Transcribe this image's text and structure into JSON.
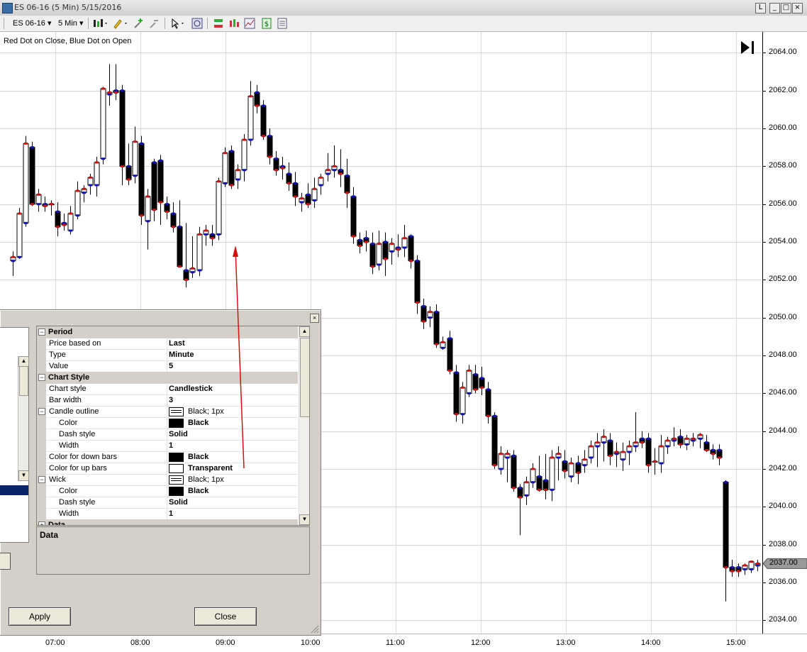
{
  "window": {
    "title": "ES 06-16 (5 Min)  5/15/2016",
    "buttons": [
      "L",
      "_",
      "□",
      "×"
    ]
  },
  "toolbar": {
    "instrument": "ES 06-16",
    "interval": "5 Min"
  },
  "chart": {
    "label": "Red Dot on Close, Blue Dot on Open",
    "current_price": "2037.00"
  },
  "chart_data": {
    "type": "candlestick",
    "title": "",
    "price_ticks": [
      "2064.00",
      "2062.00",
      "2060.00",
      "2058.00",
      "2056.00",
      "2054.00",
      "2052.00",
      "2050.00",
      "2048.00",
      "2046.00",
      "2044.00",
      "2042.00",
      "2040.00",
      "2038.00",
      "2036.00",
      "2034.00"
    ],
    "time_ticks": [
      "07:00",
      "08:00",
      "09:00",
      "10:00",
      "11:00",
      "12:00",
      "13:00",
      "14:00",
      "15:00"
    ],
    "ylim": [
      2033.3,
      2065.1
    ],
    "grid": true,
    "colors": {
      "up_fill": "#ffffff",
      "down_fill": "#000000",
      "outline": "#000000",
      "close_dot": "#d01010",
      "open_dot": "#1010c0"
    },
    "bars": [
      [
        2053.0,
        2053.5,
        2052.2,
        2053.2
      ],
      [
        2053.2,
        2055.8,
        2053.1,
        2055.5
      ],
      [
        2055.0,
        2059.6,
        2054.8,
        2059.2
      ],
      [
        2059.0,
        2059.3,
        2055.9,
        2056.0
      ],
      [
        2056.0,
        2056.8,
        2055.6,
        2056.5
      ],
      [
        2056.0,
        2056.4,
        2055.6,
        2055.9
      ],
      [
        2056.0,
        2056.2,
        2055.4,
        2056.0
      ],
      [
        2055.6,
        2056.1,
        2054.3,
        2054.8
      ],
      [
        2055.0,
        2055.5,
        2054.6,
        2054.9
      ],
      [
        2054.6,
        2055.9,
        2054.4,
        2055.5
      ],
      [
        2055.4,
        2057.2,
        2055.2,
        2056.7
      ],
      [
        2056.6,
        2057.0,
        2056.1,
        2056.8
      ],
      [
        2057.0,
        2057.6,
        2056.5,
        2057.4
      ],
      [
        2057.0,
        2058.5,
        2056.4,
        2058.2
      ],
      [
        2058.4,
        2062.2,
        2058.1,
        2062.1
      ],
      [
        2061.8,
        2063.4,
        2061.2,
        2061.9
      ],
      [
        2062.0,
        2063.4,
        2061.5,
        2061.9
      ],
      [
        2062.0,
        2062.3,
        2057.0,
        2058.0
      ],
      [
        2058.0,
        2059.2,
        2057.0,
        2057.3
      ],
      [
        2057.5,
        2060.1,
        2057.1,
        2059.3
      ],
      [
        2059.2,
        2059.6,
        2054.9,
        2055.4
      ],
      [
        2055.1,
        2056.8,
        2053.6,
        2056.4
      ],
      [
        2058.2,
        2058.4,
        2055.1,
        2055.7
      ],
      [
        2058.3,
        2058.6,
        2054.9,
        2056.1
      ],
      [
        2056.0,
        2056.4,
        2055.2,
        2055.6
      ],
      [
        2055.5,
        2056.1,
        2054.5,
        2054.8
      ],
      [
        2054.8,
        2056.2,
        2053.3,
        2052.7
      ],
      [
        2052.5,
        2055.0,
        2051.6,
        2052.0
      ],
      [
        2052.4,
        2054.3,
        2052.1,
        2052.6
      ],
      [
        2052.5,
        2054.8,
        2052.2,
        2054.4
      ],
      [
        2054.4,
        2054.9,
        2053.8,
        2054.6
      ],
      [
        2054.4,
        2054.9,
        2053.8,
        2054.2
      ],
      [
        2054.4,
        2057.4,
        2054.1,
        2057.2
      ],
      [
        2057.1,
        2059.0,
        2056.9,
        2058.7
      ],
      [
        2058.8,
        2059.1,
        2056.8,
        2057.0
      ],
      [
        2057.3,
        2058.1,
        2056.8,
        2057.8
      ],
      [
        2057.8,
        2059.7,
        2057.2,
        2059.4
      ],
      [
        2059.4,
        2062.5,
        2059.1,
        2061.7
      ],
      [
        2061.9,
        2062.3,
        2060.8,
        2061.2
      ],
      [
        2061.2,
        2061.5,
        2059.4,
        2059.6
      ],
      [
        2059.6,
        2060.0,
        2058.1,
        2058.5
      ],
      [
        2058.4,
        2058.8,
        2057.5,
        2057.8
      ],
      [
        2058.0,
        2058.5,
        2057.3,
        2057.9
      ],
      [
        2057.6,
        2058.2,
        2056.7,
        2057.1
      ],
      [
        2057.1,
        2057.7,
        2055.9,
        2056.4
      ],
      [
        2056.1,
        2056.6,
        2055.6,
        2056.3
      ],
      [
        2056.5,
        2057.1,
        2055.8,
        2056.0
      ],
      [
        2056.2,
        2057.4,
        2055.8,
        2056.8
      ],
      [
        2057.0,
        2057.6,
        2056.5,
        2057.4
      ],
      [
        2057.6,
        2058.7,
        2057.2,
        2057.8
      ],
      [
        2057.8,
        2059.1,
        2057.4,
        2058.0
      ],
      [
        2057.8,
        2058.9,
        2056.9,
        2057.6
      ],
      [
        2057.5,
        2058.4,
        2055.8,
        2056.6
      ],
      [
        2056.4,
        2056.9,
        2053.9,
        2054.3
      ],
      [
        2054.1,
        2054.5,
        2053.4,
        2053.8
      ],
      [
        2054.2,
        2054.6,
        2053.5,
        2054.0
      ],
      [
        2053.9,
        2054.5,
        2052.3,
        2052.7
      ],
      [
        2052.8,
        2054.6,
        2052.5,
        2053.9
      ],
      [
        2054.0,
        2054.5,
        2052.2,
        2053.1
      ],
      [
        2053.5,
        2054.2,
        2052.8,
        2053.9
      ],
      [
        2053.7,
        2054.4,
        2053.2,
        2053.6
      ],
      [
        2053.7,
        2054.9,
        2053.2,
        2054.2
      ],
      [
        2054.3,
        2054.4,
        2052.6,
        2053.0
      ],
      [
        2053.0,
        2053.3,
        2050.2,
        2050.8
      ],
      [
        2050.6,
        2051.0,
        2049.4,
        2049.8
      ],
      [
        2050.0,
        2050.6,
        2049.5,
        2050.3
      ],
      [
        2050.3,
        2050.7,
        2048.4,
        2048.6
      ],
      [
        2048.4,
        2049.0,
        2048.3,
        2048.7
      ],
      [
        2048.9,
        2049.3,
        2047.0,
        2047.2
      ],
      [
        2047.1,
        2047.5,
        2044.5,
        2044.9
      ],
      [
        2044.9,
        2046.6,
        2044.4,
        2046.3
      ],
      [
        2046.0,
        2047.5,
        2045.8,
        2047.2
      ],
      [
        2047.0,
        2047.5,
        2046.0,
        2046.2
      ],
      [
        2046.8,
        2047.4,
        2045.9,
        2046.3
      ],
      [
        2046.2,
        2046.6,
        2044.4,
        2044.8
      ],
      [
        2044.8,
        2045.0,
        2042.0,
        2042.2
      ],
      [
        2042.0,
        2043.2,
        2041.7,
        2042.8
      ],
      [
        2042.6,
        2043.0,
        2041.3,
        2042.8
      ],
      [
        2042.7,
        2043.0,
        2040.8,
        2041.0
      ],
      [
        2041.0,
        2041.2,
        2038.5,
        2040.5
      ],
      [
        2040.6,
        2041.6,
        2040.1,
        2041.3
      ],
      [
        2041.3,
        2042.3,
        2041.0,
        2042.0
      ],
      [
        2041.6,
        2042.7,
        2040.8,
        2040.9
      ],
      [
        2041.4,
        2042.8,
        2040.4,
        2040.9
      ],
      [
        2040.9,
        2043.0,
        2040.3,
        2042.6
      ],
      [
        2042.6,
        2043.2,
        2041.4,
        2042.8
      ],
      [
        2042.4,
        2043.0,
        2041.5,
        2041.9
      ],
      [
        2041.6,
        2042.6,
        2041.3,
        2042.3
      ],
      [
        2042.3,
        2042.7,
        2041.2,
        2041.8
      ],
      [
        2042.2,
        2043.0,
        2041.8,
        2042.5
      ],
      [
        2042.6,
        2043.5,
        2042.3,
        2043.2
      ],
      [
        2043.2,
        2043.9,
        2042.1,
        2043.4
      ],
      [
        2043.4,
        2044.1,
        2042.4,
        2043.7
      ],
      [
        2043.5,
        2043.9,
        2042.2,
        2042.7
      ],
      [
        2042.8,
        2043.4,
        2042.1,
        2042.9
      ],
      [
        2042.5,
        2043.4,
        2041.9,
        2042.9
      ],
      [
        2042.9,
        2043.5,
        2042.2,
        2043.2
      ],
      [
        2043.2,
        2045.0,
        2042.9,
        2043.4
      ],
      [
        2043.6,
        2044.0,
        2043.1,
        2043.4
      ],
      [
        2043.6,
        2043.9,
        2041.8,
        2042.2
      ],
      [
        2042.4,
        2043.1,
        2041.7,
        2042.4
      ],
      [
        2042.3,
        2043.8,
        2041.8,
        2043.2
      ],
      [
        2043.2,
        2043.7,
        2042.8,
        2043.5
      ],
      [
        2043.5,
        2044.2,
        2043.2,
        2043.6
      ],
      [
        2043.7,
        2044.1,
        2043.1,
        2043.3
      ],
      [
        2043.3,
        2043.8,
        2043.0,
        2043.6
      ],
      [
        2043.5,
        2043.9,
        2043.2,
        2043.6
      ],
      [
        2043.6,
        2043.9,
        2043.1,
        2043.8
      ],
      [
        2043.4,
        2043.8,
        2042.9,
        2043.0
      ],
      [
        2043.0,
        2043.3,
        2042.5,
        2042.8
      ],
      [
        2043.0,
        2043.3,
        2042.2,
        2042.6
      ],
      [
        2041.3,
        2041.4,
        2035.0,
        2036.8
      ],
      [
        2036.8,
        2037.2,
        2036.3,
        2036.6
      ],
      [
        2036.8,
        2037.0,
        2036.3,
        2036.6
      ],
      [
        2036.7,
        2037.0,
        2036.4,
        2036.9
      ],
      [
        2036.7,
        2037.1,
        2036.5,
        2037.1
      ],
      [
        2036.9,
        2037.2,
        2036.6,
        2037.0
      ]
    ]
  },
  "dialog": {
    "close_label": "×",
    "desc_title": "Data",
    "apply_label": "Apply",
    "close_button_label": "Close",
    "rows": [
      {
        "kind": "cat",
        "name": "Period",
        "expander": "−"
      },
      {
        "kind": "prop",
        "name": "Price based on",
        "value": "Last",
        "indent": 0
      },
      {
        "kind": "prop",
        "name": "Type",
        "value": "Minute",
        "indent": 0
      },
      {
        "kind": "prop",
        "name": "Value",
        "value": "5",
        "indent": 0
      },
      {
        "kind": "cat",
        "name": "Chart Style",
        "expander": "−"
      },
      {
        "kind": "prop",
        "name": "Chart style",
        "value": "Candlestick",
        "indent": 0
      },
      {
        "kind": "prop",
        "name": "Bar width",
        "value": "3",
        "indent": 0
      },
      {
        "kind": "line",
        "name": "Candle outline",
        "value": "Black; 1px",
        "indent": 0,
        "expander": "−"
      },
      {
        "kind": "color",
        "name": "Color",
        "value": "Black",
        "color": "#000000",
        "indent": 1
      },
      {
        "kind": "prop",
        "name": "Dash style",
        "value": "Solid",
        "indent": 1
      },
      {
        "kind": "prop",
        "name": "Width",
        "value": "1",
        "indent": 1
      },
      {
        "kind": "color",
        "name": "Color for down bars",
        "value": "Black",
        "color": "#000000",
        "indent": 0
      },
      {
        "kind": "color",
        "name": "Color for up bars",
        "value": "Transparent",
        "color": "#ffffff",
        "indent": 0
      },
      {
        "kind": "line",
        "name": "Wick",
        "value": "Black; 1px",
        "indent": 0,
        "expander": "−"
      },
      {
        "kind": "color",
        "name": "Color",
        "value": "Black",
        "color": "#000000",
        "indent": 1
      },
      {
        "kind": "prop",
        "name": "Dash style",
        "value": "Solid",
        "indent": 1
      },
      {
        "kind": "prop",
        "name": "Width",
        "value": "1",
        "indent": 1
      },
      {
        "kind": "cat",
        "name": "Data",
        "expander": "+"
      }
    ]
  }
}
